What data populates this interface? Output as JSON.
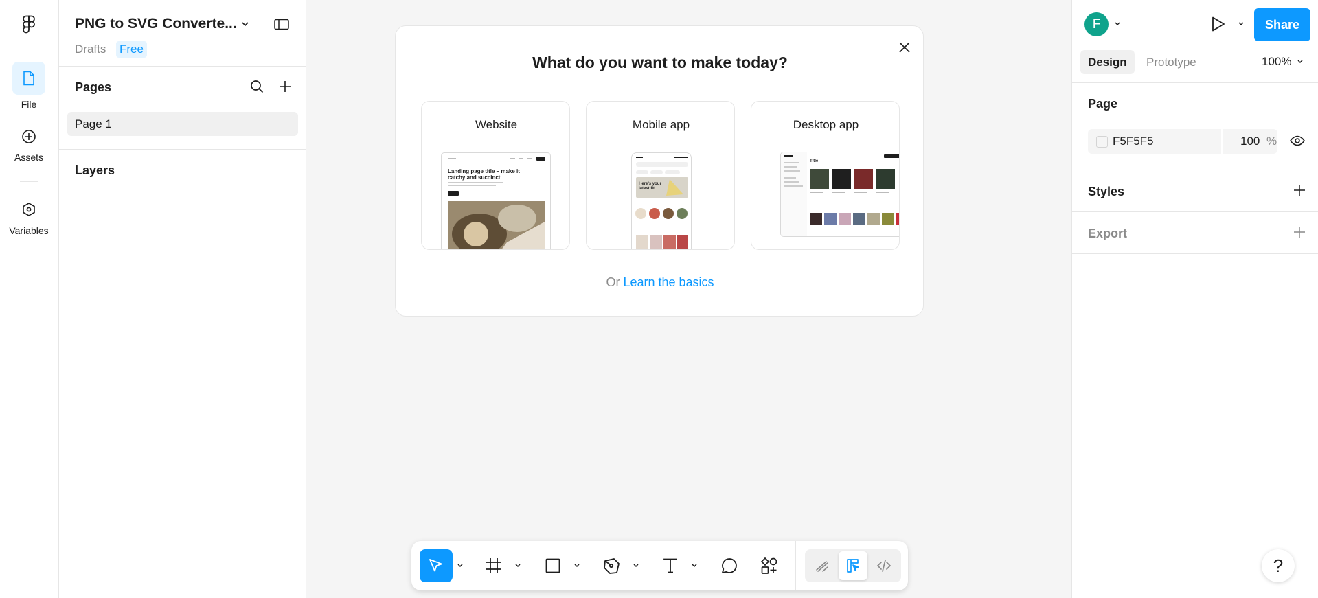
{
  "rail": {
    "items": [
      {
        "label": "File",
        "icon": "file-icon",
        "active": true
      },
      {
        "label": "Assets",
        "icon": "assets-icon",
        "active": false
      },
      {
        "label": "Variables",
        "icon": "variables-icon",
        "active": false
      }
    ]
  },
  "file": {
    "title": "PNG to SVG Converte...",
    "location": "Drafts",
    "plan": "Free"
  },
  "pages": {
    "heading": "Pages",
    "items": [
      "Page 1"
    ]
  },
  "layers": {
    "heading": "Layers"
  },
  "header": {
    "avatar_initial": "F",
    "share_label": "Share"
  },
  "props": {
    "tabs": [
      "Design",
      "Prototype"
    ],
    "active_tab": "Design",
    "zoom": "100%",
    "page_heading": "Page",
    "fill_hex": "F5F5F5",
    "fill_opacity": "100",
    "fill_opacity_unit": "%",
    "styles_heading": "Styles",
    "export_heading": "Export",
    "help_label": "?"
  },
  "modal": {
    "title": "What do you want to make today?",
    "cards": [
      {
        "label": "Website",
        "thumb_headline": "Landing page title – make it catchy and succinct"
      },
      {
        "label": "Mobile app",
        "thumb_headline": "Here's your latest fit"
      },
      {
        "label": "Desktop app",
        "thumb_headline": "Title"
      }
    ],
    "footer_prefix": "Or",
    "footer_link": "Learn the basics"
  },
  "toolbar": {
    "tools": [
      "move-tool",
      "frame-tool",
      "rectangle-tool",
      "pen-tool",
      "text-tool",
      "comment-tool",
      "actions-tool"
    ],
    "modes": [
      "draw-mode",
      "design-mode",
      "dev-mode"
    ],
    "active_mode": "design-mode"
  },
  "colors": {
    "accent": "#0d99ff",
    "canvas": "#f5f5f5",
    "avatar": "#0fa38c",
    "panel": "#ffffff",
    "border": "#e6e6e6"
  }
}
